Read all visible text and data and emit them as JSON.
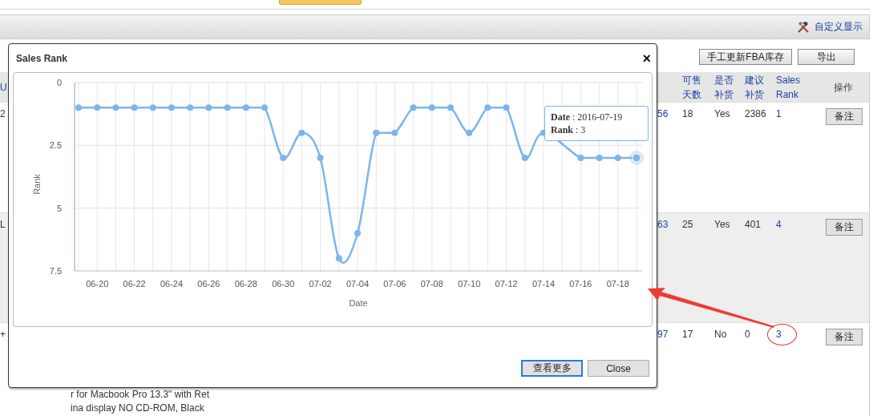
{
  "header": {
    "link": "自定义显示"
  },
  "toolbar": {
    "buttons": [
      "手工更新FBA库存",
      "导出"
    ]
  },
  "table": {
    "columns": [
      {
        "kind": "text",
        "label": "U"
      },
      {
        "kind": "title"
      },
      {
        "kind": "link"
      },
      {
        "kind": "text",
        "label": "可售天数"
      },
      {
        "kind": "text",
        "label": "是否补货"
      },
      {
        "kind": "text",
        "label": "建议补货"
      },
      {
        "kind": "link",
        "label": "Sales Rank"
      },
      {
        "kind": "action",
        "label": "操作"
      }
    ],
    "rows": [
      {
        "column_1": "2",
        "column_3": "56",
        "column_4": "18",
        "column_5": "Yes",
        "column_6": "2386",
        "column_7": "1",
        "column_8": "备注",
        "circled": false,
        "shaded": false
      },
      {
        "column_1": "L",
        "column_3": "63",
        "column_4": "25",
        "column_5": "Yes",
        "column_6": "401",
        "column_7": "4",
        "column_8": "备注",
        "circled": false,
        "shaded": true
      },
      {
        "column_1": "+",
        "column_2": "r for Macbook Pro 13.3\" with Ret\nina display NO CD-ROM, Black",
        "column_3": "97",
        "column_4": "17",
        "column_5": "No",
        "column_6": "0",
        "column_7": "3",
        "column_8": "备注",
        "circled": true,
        "shaded": false
      }
    ]
  },
  "dialog": {
    "title": "Sales Rank",
    "close": "×",
    "chart_data": {
      "type": "line",
      "xlabel": "Date",
      "ylabel": "Rank",
      "categories": [
        null,
        "06-20",
        null,
        "06-22",
        null,
        "06-24",
        null,
        "06-26",
        null,
        "06-28",
        null,
        "06-30",
        null,
        "07-02",
        null,
        "07-04",
        null,
        "07-06",
        null,
        "07-08",
        null,
        "07-10",
        null,
        "07-12",
        null,
        "07-14",
        null,
        "07-16",
        null,
        "07-18",
        null
      ],
      "grid": true,
      "series": [
        {
          "color": "#7cb5ec",
          "marker": true,
          "values": [
            1,
            1,
            1,
            1,
            1,
            1,
            1,
            1,
            1,
            1,
            1,
            3,
            2,
            3,
            7,
            6,
            2,
            2,
            1,
            1,
            1,
            2,
            1,
            1,
            3,
            2,
            null,
            3,
            3,
            3,
            3
          ]
        }
      ],
      "ylim": [
        7.5,
        0
      ],
      "yticks": [
        {
          "value": 0,
          "label": "0"
        },
        {
          "value": 2.5,
          "label": "2.5"
        },
        {
          "value": 5,
          "label": "5"
        },
        {
          "value": 7.5,
          "label": "7.5"
        }
      ]
    },
    "tooltip": {
      "lines": [
        "**Date** : 2016-07-19",
        "**Rank** : 3"
      ]
    },
    "buttons": [
      {
        "label": "查看更多",
        "focused": true
      },
      {
        "label": "Close",
        "focused": false
      }
    ]
  }
}
